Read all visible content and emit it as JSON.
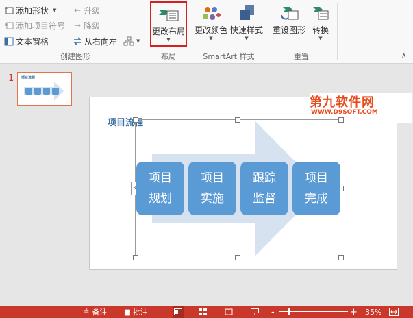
{
  "ribbon": {
    "create_graphic": {
      "label": "创建图形",
      "add_shape": "添加形状",
      "add_bullet": "添加项目符号",
      "text_pane": "文本窗格",
      "promote": "升级",
      "demote": "降级",
      "right_to_left": "从右向左"
    },
    "layouts": {
      "label": "布局",
      "change_layout": "更改布局"
    },
    "smartart_styles": {
      "label": "SmartArt 样式",
      "change_colors": "更改颜色",
      "quick_styles": "快速样式"
    },
    "reset": {
      "label": "重置",
      "reset_graphic": "重设图形",
      "convert": "转换"
    }
  },
  "thumbnail": {
    "number": "1",
    "title": "项目流程"
  },
  "slide": {
    "title": "项目流程",
    "watermark_main": "第九软件网",
    "watermark_sub": "WWW.D9SOFT.COM",
    "steps": [
      {
        "line1": "项目",
        "line2": "规划"
      },
      {
        "line1": "项目",
        "line2": "实施"
      },
      {
        "line1": "跟踪",
        "line2": "监督"
      },
      {
        "line1": "项目",
        "line2": "完成"
      }
    ]
  },
  "statusbar": {
    "notes": "备注",
    "comments": "批注",
    "zoom_minus": "-",
    "zoom_plus": "+",
    "zoom": "35%",
    "zoom_fraction": 0.35
  },
  "colors": {
    "accent": "#5b9bd5",
    "arrow": "#d6e2f0",
    "highlight": "#d42020",
    "thumb_border": "#e0744a",
    "statusbar": "#c9382a",
    "watermark": "#e84c1e"
  }
}
